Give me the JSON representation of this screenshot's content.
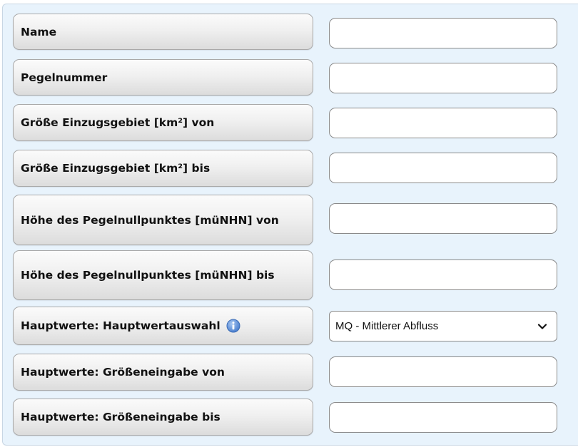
{
  "form": {
    "fields": [
      {
        "label": "Name",
        "type": "text",
        "value": ""
      },
      {
        "label": "Pegelnummer",
        "type": "text",
        "value": ""
      },
      {
        "label": "Größe Einzugsgebiet [km²] von",
        "type": "text",
        "value": ""
      },
      {
        "label": "Größe Einzugsgebiet [km²] bis",
        "type": "text",
        "value": ""
      },
      {
        "label": "Höhe des Pegelnullpunktes [müNHN] von",
        "type": "text",
        "value": ""
      },
      {
        "label": "Höhe des Pegelnullpunktes [müNHN] bis",
        "type": "text",
        "value": ""
      },
      {
        "label": "Hauptwerte: Hauptwertauswahl",
        "type": "select",
        "value": "MQ - Mittlerer Abfluss",
        "icon": "info-icon"
      },
      {
        "label": "Hauptwerte: Größeneingabe von",
        "type": "text",
        "value": ""
      },
      {
        "label": "Hauptwerte: Größeneingabe bis",
        "type": "text",
        "value": ""
      }
    ]
  },
  "colors": {
    "panel_background": "#e8f3fc",
    "info_icon": "#5b8fd6"
  }
}
